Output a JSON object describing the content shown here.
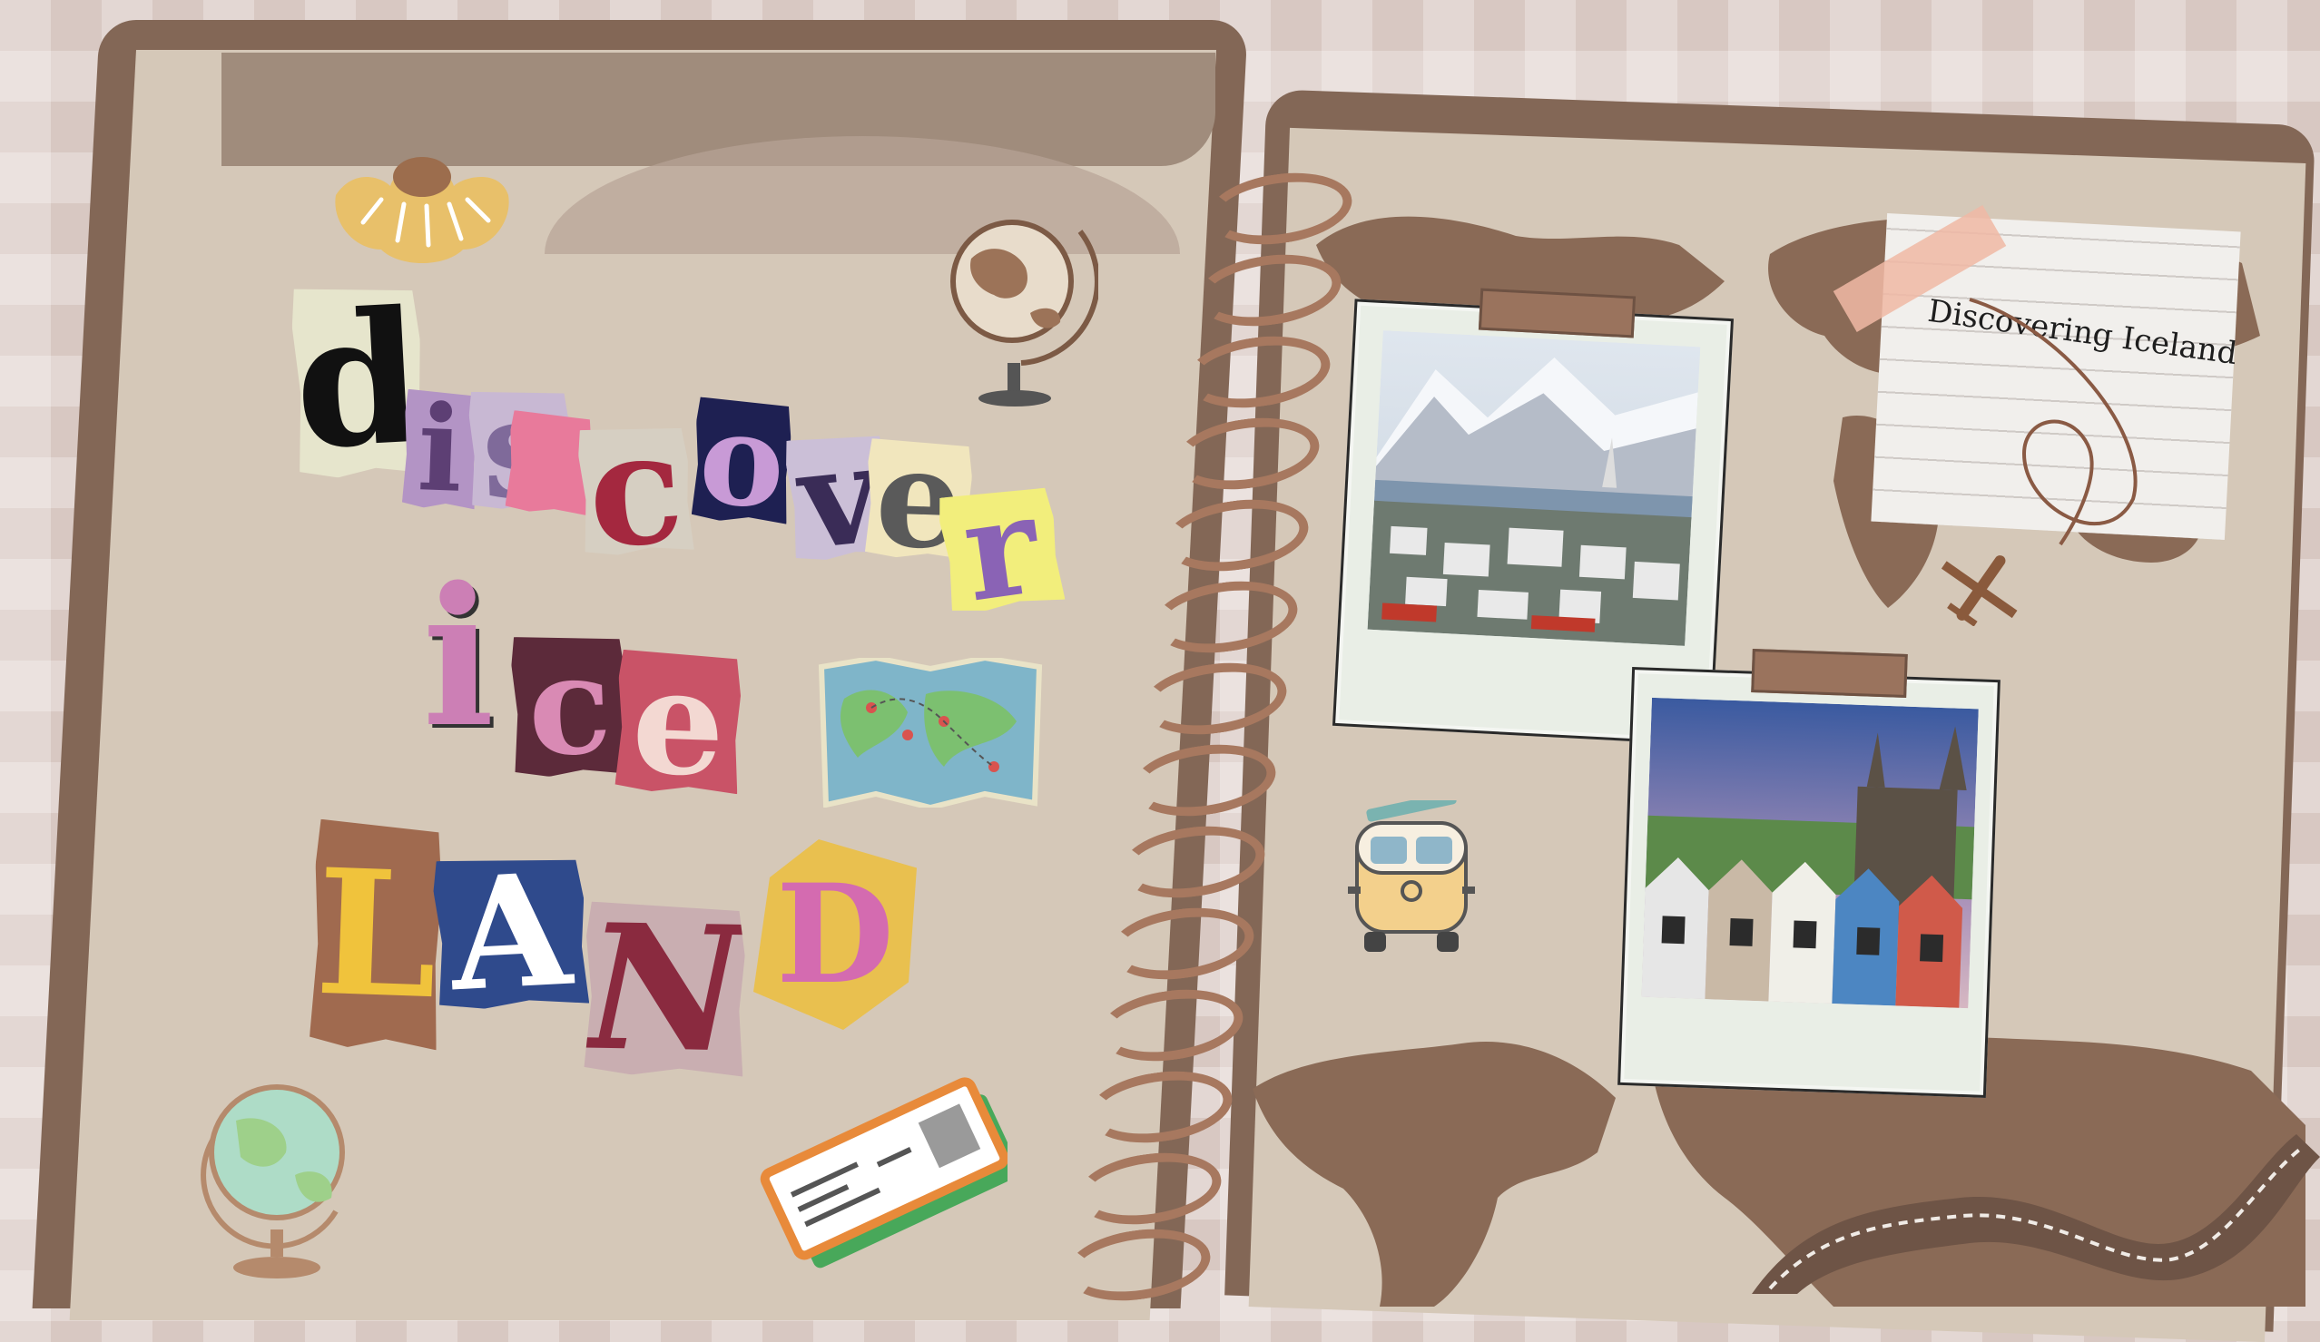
{
  "title_letters": {
    "line1": [
      "d",
      "i",
      "s",
      "c",
      "o",
      "v",
      "e",
      "r"
    ],
    "line2": [
      "i",
      "c",
      "e"
    ],
    "line3": [
      "L",
      "A",
      "N",
      "D"
    ]
  },
  "note": {
    "text": "Discovering Iceland"
  },
  "colors": {
    "background": "#d8c8c2",
    "cover": "#836756",
    "page": "#d5c8b8",
    "ring": "#a7785f",
    "map": "#8a6a56"
  },
  "icons": {
    "flower": "flower-sticker-icon",
    "globe_top": "desk-globe-icon",
    "globe_bottom": "green-globe-icon",
    "map": "folded-map-icon",
    "tickets": "boarding-pass-icon",
    "van": "camper-van-icon",
    "plane": "airplane-icon",
    "film": "film-strip-icon"
  }
}
